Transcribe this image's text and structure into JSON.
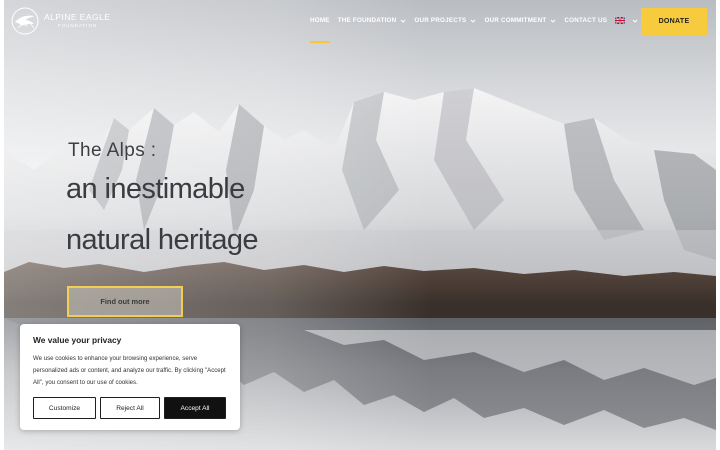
{
  "brand": {
    "name": "ALPINE EAGLE",
    "tagline": "FOUNDATION",
    "logo_icon": "eagle-logo-icon"
  },
  "nav": {
    "items": [
      {
        "label": "HOME",
        "active": true,
        "has_dropdown": false
      },
      {
        "label": "THE FOUNDATION",
        "active": false,
        "has_dropdown": true
      },
      {
        "label": "OUR PROJECTS",
        "active": false,
        "has_dropdown": true
      },
      {
        "label": "OUR COMMITMENT",
        "active": false,
        "has_dropdown": true
      },
      {
        "label": "CONTACT US",
        "active": false,
        "has_dropdown": false
      }
    ],
    "language_icon": "uk-flag-icon",
    "donate_label": "DONATE"
  },
  "hero": {
    "kicker": "The Alps :",
    "line1": "an inestimable",
    "line2": "natural heritage",
    "cta_label": "Find out more"
  },
  "cookie": {
    "title": "We value your privacy",
    "body": "We use cookies to enhance your browsing experience, serve personalized ads or content, and analyze our traffic. By clicking \"Accept All\", you consent to our use of cookies.",
    "customize_label": "Customize",
    "reject_label": "Reject All",
    "accept_label": "Accept All"
  },
  "colors": {
    "accent": "#f6cb3d",
    "header_text": "#ffffff",
    "hero_text": "#3a3c41"
  }
}
